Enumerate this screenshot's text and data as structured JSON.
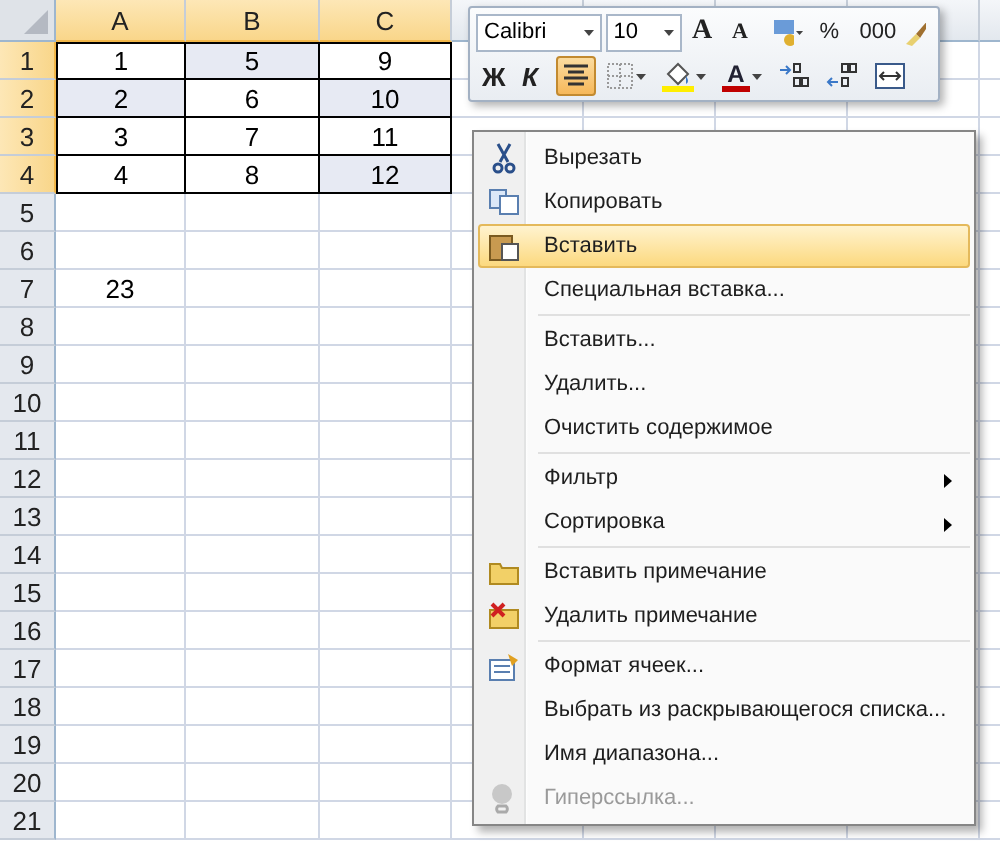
{
  "sheet": {
    "columns": [
      "A",
      "B",
      "C",
      "",
      "",
      "",
      "",
      ""
    ],
    "rows": [
      {
        "number": "1",
        "cells": [
          {
            "text": "1",
            "shaded": false
          },
          {
            "text": "5",
            "shaded": true
          },
          {
            "text": "9",
            "shaded": false
          }
        ]
      },
      {
        "number": "2",
        "cells": [
          {
            "text": "2",
            "shaded": true
          },
          {
            "text": "6",
            "shaded": false
          },
          {
            "text": "10",
            "shaded": true
          }
        ]
      },
      {
        "number": "3",
        "cells": [
          {
            "text": "3",
            "shaded": false
          },
          {
            "text": "7",
            "shaded": false
          },
          {
            "text": "11",
            "shaded": false
          }
        ]
      },
      {
        "number": "4",
        "cells": [
          {
            "text": "4",
            "shaded": false
          },
          {
            "text": "8",
            "shaded": false
          },
          {
            "text": "12",
            "shaded": true
          }
        ]
      },
      {
        "number": "5",
        "cells": []
      },
      {
        "number": "6",
        "cells": []
      },
      {
        "number": "7",
        "cells": [
          {
            "text": "23",
            "shaded": false
          }
        ]
      },
      {
        "number": "8",
        "cells": []
      },
      {
        "number": "9",
        "cells": []
      },
      {
        "number": "10",
        "cells": []
      },
      {
        "number": "11",
        "cells": []
      },
      {
        "number": "12",
        "cells": []
      },
      {
        "number": "13",
        "cells": []
      },
      {
        "number": "14",
        "cells": []
      },
      {
        "number": "15",
        "cells": []
      },
      {
        "number": "16",
        "cells": []
      },
      {
        "number": "17",
        "cells": []
      },
      {
        "number": "18",
        "cells": []
      },
      {
        "number": "19",
        "cells": []
      },
      {
        "number": "20",
        "cells": []
      },
      {
        "number": "21",
        "cells": []
      }
    ]
  },
  "mini_toolbar": {
    "font": "Calibri",
    "size": "10",
    "row_1": [
      {
        "kind": "grow",
        "text": "A",
        "selected": false,
        "dropdown": false
      },
      {
        "kind": "shrink",
        "text": "A",
        "selected": false,
        "dropdown": false
      },
      {
        "kind": "currency",
        "selected": false,
        "dropdown": true
      },
      {
        "kind": "text",
        "text": "%",
        "selected": false,
        "dropdown": false
      },
      {
        "kind": "text",
        "text": "000",
        "selected": false,
        "dropdown": false
      },
      {
        "kind": "brush",
        "selected": false,
        "dropdown": false
      }
    ],
    "row_2": [
      {
        "kind": "bold",
        "text": "Ж",
        "selected": false,
        "dropdown": false
      },
      {
        "kind": "italic",
        "text": "К",
        "selected": false,
        "dropdown": false
      },
      {
        "kind": "center",
        "selected": true,
        "dropdown": false
      },
      {
        "kind": "borders",
        "selected": false,
        "dropdown": true
      },
      {
        "kind": "fill",
        "selected": false,
        "dropdown": true
      },
      {
        "kind": "fontcolor",
        "text": "A",
        "selected": false,
        "dropdown": true
      },
      {
        "kind": "incdec",
        "selected": false,
        "dropdown": false
      },
      {
        "kind": "decdec",
        "selected": false,
        "dropdown": false
      },
      {
        "kind": "merge",
        "selected": false,
        "dropdown": false
      }
    ]
  },
  "context_menu": [
    {
      "kind": "item",
      "label": "Вырезать",
      "highlighted": false,
      "disabled": false,
      "submenu": false
    },
    {
      "kind": "item",
      "label": "Копировать",
      "highlighted": false,
      "disabled": false,
      "submenu": false
    },
    {
      "kind": "item",
      "label": "Вставить",
      "highlighted": true,
      "disabled": false,
      "submenu": false
    },
    {
      "kind": "item",
      "label": "Специальная вставка...",
      "highlighted": false,
      "disabled": false,
      "submenu": false
    },
    {
      "kind": "separator"
    },
    {
      "kind": "item",
      "label": "Вставить...",
      "highlighted": false,
      "disabled": false,
      "submenu": false
    },
    {
      "kind": "item",
      "label": "Удалить...",
      "highlighted": false,
      "disabled": false,
      "submenu": false
    },
    {
      "kind": "item",
      "label": "Очистить содержимое",
      "highlighted": false,
      "disabled": false,
      "submenu": false
    },
    {
      "kind": "separator"
    },
    {
      "kind": "item",
      "label": "Фильтр",
      "highlighted": false,
      "disabled": false,
      "submenu": true
    },
    {
      "kind": "item",
      "label": "Сортировка",
      "highlighted": false,
      "disabled": false,
      "submenu": true
    },
    {
      "kind": "separator"
    },
    {
      "kind": "item",
      "label": "Вставить примечание",
      "highlighted": false,
      "disabled": false,
      "submenu": false
    },
    {
      "kind": "item",
      "label": "Удалить примечание",
      "highlighted": false,
      "disabled": false,
      "submenu": false
    },
    {
      "kind": "separator"
    },
    {
      "kind": "item",
      "label": "Формат ячеек...",
      "highlighted": false,
      "disabled": false,
      "submenu": false
    },
    {
      "kind": "item",
      "label": "Выбрать из раскрывающегося списка...",
      "highlighted": false,
      "disabled": false,
      "submenu": false
    },
    {
      "kind": "item",
      "label": "Имя диапазона...",
      "highlighted": false,
      "disabled": false,
      "submenu": false
    },
    {
      "kind": "item",
      "label": "Гиперссылка...",
      "highlighted": false,
      "disabled": true,
      "submenu": false
    }
  ]
}
